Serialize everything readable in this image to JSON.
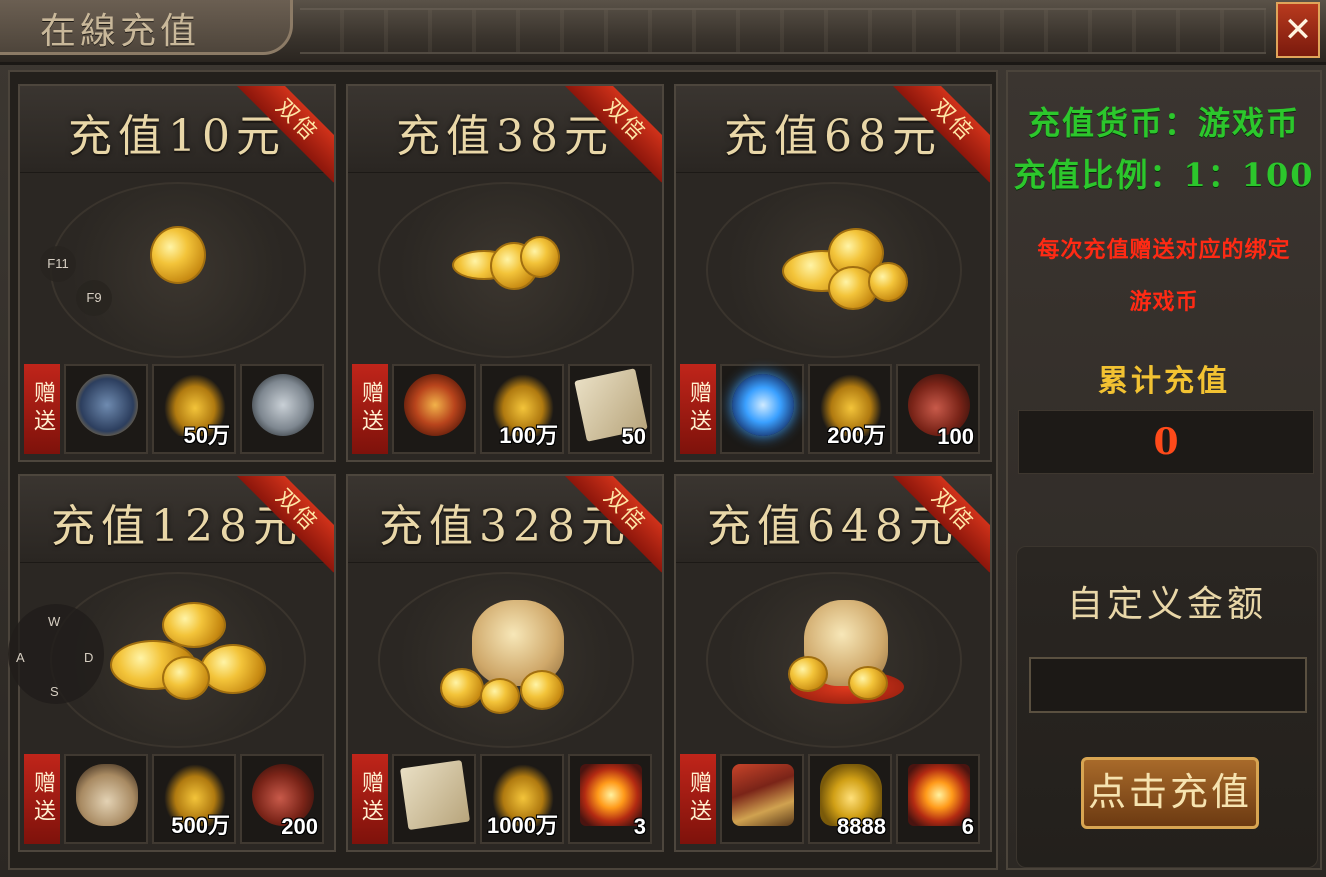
{
  "window": {
    "title": "在線充值",
    "close_label": "✕"
  },
  "packages": [
    {
      "price": "充值10元",
      "badge": "双倍",
      "gift_label": "赠送",
      "gifts": [
        {
          "icon": "treasure-chest-icon",
          "qty": ""
        },
        {
          "icon": "gold-coins-icon",
          "qty": "50万"
        },
        {
          "icon": "patrol-token-icon",
          "qty": ""
        }
      ]
    },
    {
      "price": "充值38元",
      "badge": "双倍",
      "gift_label": "赠送",
      "gifts": [
        {
          "icon": "amulet-icon",
          "qty": ""
        },
        {
          "icon": "gold-coins-icon",
          "qty": "100万"
        },
        {
          "icon": "scroll-paper-icon",
          "qty": "50"
        }
      ]
    },
    {
      "price": "充值68元",
      "badge": "双倍",
      "gift_label": "赠送",
      "gifts": [
        {
          "icon": "magic-orb-icon",
          "qty": ""
        },
        {
          "icon": "gold-coins-icon",
          "qty": "200万"
        },
        {
          "icon": "gourd-icon",
          "qty": "100"
        }
      ]
    },
    {
      "price": "充值128元",
      "badge": "双倍",
      "gift_label": "赠送",
      "gifts": [
        {
          "icon": "pouch-icon",
          "qty": ""
        },
        {
          "icon": "gold-coins-icon",
          "qty": "500万"
        },
        {
          "icon": "gourd-icon",
          "qty": "200"
        }
      ]
    },
    {
      "price": "充值328元",
      "badge": "双倍",
      "gift_label": "赠送",
      "gifts": [
        {
          "icon": "scroll-paper-icon",
          "qty": ""
        },
        {
          "icon": "gold-coins-icon",
          "qty": "1000万"
        },
        {
          "icon": "fire-book-icon",
          "qty": "3"
        }
      ]
    },
    {
      "price": "充值648元",
      "badge": "双倍",
      "gift_label": "赠送",
      "gifts": [
        {
          "icon": "warrior-figure-icon",
          "qty": ""
        },
        {
          "icon": "gold-ingot-icon",
          "qty": "8888"
        },
        {
          "icon": "fire-book-icon",
          "qty": "6"
        }
      ]
    }
  ],
  "side": {
    "currency_line": "充值货币：游戏币",
    "ratio_line": "充值比例：1：100",
    "bonus_note_1": "每次充值赠送对应的绑定",
    "bonus_note_2": "游戏币",
    "total_label": "累计充值",
    "total_value": "0",
    "custom_label": "自定义金额",
    "custom_value": "",
    "pay_button": "点击充值"
  },
  "overlay": {
    "hint_f11": "F11",
    "hint_f9": "F9",
    "dpad": {
      "up": "W",
      "left": "A",
      "right": "D",
      "down": "S"
    }
  },
  "colors": {
    "accent_green": "#2cc72c",
    "accent_red": "#ff2a14",
    "accent_yellow": "#f2c232",
    "ribbon_red": "#c0251a"
  }
}
